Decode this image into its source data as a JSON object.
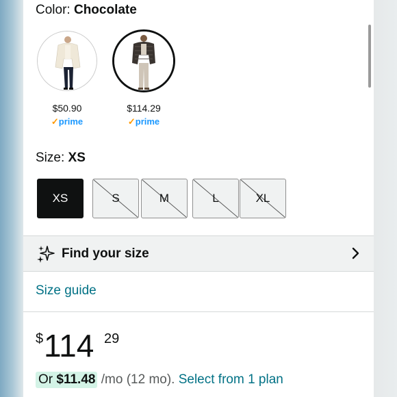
{
  "color": {
    "label": "Color: ",
    "value": "Chocolate"
  },
  "variants": [
    {
      "price": "$50.90",
      "prime": "prime",
      "selected": false
    },
    {
      "price": "$114.29",
      "prime": "prime",
      "selected": true
    }
  ],
  "size": {
    "label": "Size: ",
    "value": "XS",
    "options": [
      {
        "label": "XS",
        "available": true,
        "selected": true
      },
      {
        "label": "S",
        "available": false,
        "selected": false
      },
      {
        "label": "M",
        "available": false,
        "selected": false
      },
      {
        "label": "L",
        "available": false,
        "selected": false
      },
      {
        "label": "XL",
        "available": false,
        "selected": false
      }
    ]
  },
  "find_size": {
    "label": "Find your size",
    "icon": "sparkle-icon"
  },
  "size_guide": {
    "label": "Size guide"
  },
  "price": {
    "symbol": "$",
    "whole": "114",
    "fraction": "29"
  },
  "installment": {
    "prefix": "Or ",
    "amount": "$11.48",
    "term": " /mo (12 mo). ",
    "link": "Select from 1 plan"
  },
  "colors": {
    "link": "#007185",
    "prime": "#1a98ff",
    "highlight": "#d3f3e6"
  }
}
